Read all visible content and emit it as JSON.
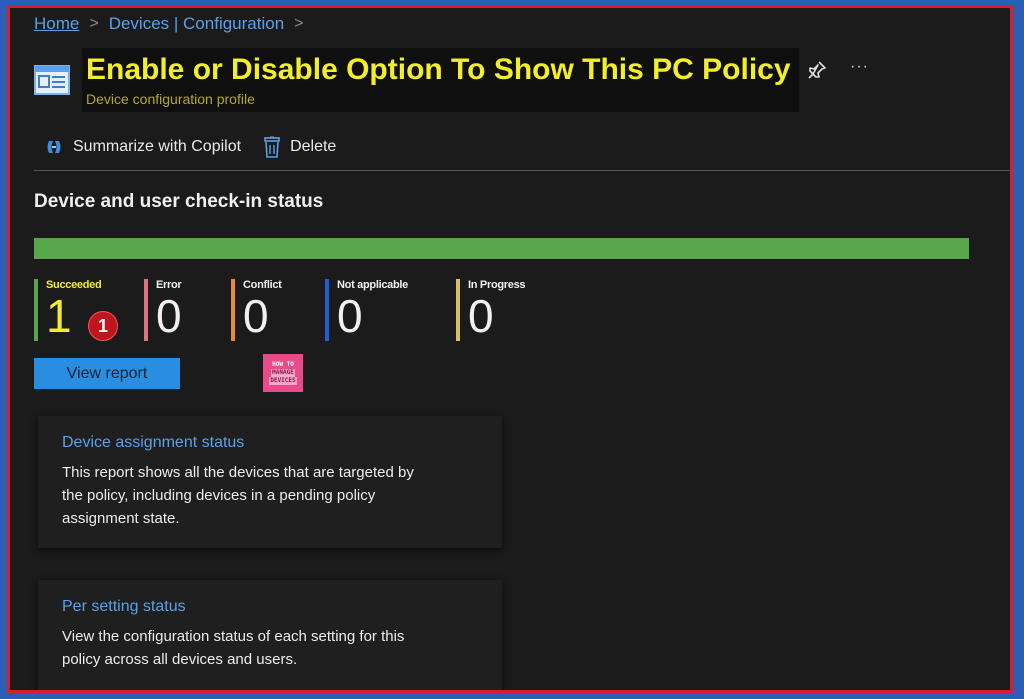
{
  "breadcrumb": {
    "home": "Home",
    "section": "Devices | Configuration",
    "separator": ">"
  },
  "header": {
    "title": "Enable or Disable Option To Show This PC Policy",
    "subtitle": "Device configuration profile",
    "more_label": "···"
  },
  "toolbar": {
    "copilot_label": "Summarize with Copilot",
    "delete_label": "Delete"
  },
  "checkin": {
    "title": "Device and user check-in status",
    "progress_succeeded_fraction": 1.0,
    "stats": [
      {
        "label": "Succeeded",
        "value": "1",
        "color": "#57a64a"
      },
      {
        "label": "Error",
        "value": "0",
        "color": "#e0737b"
      },
      {
        "label": "Conflict",
        "value": "0",
        "color": "#e9893a"
      },
      {
        "label": "Not applicable",
        "value": "0",
        "color": "#1f5fd6"
      },
      {
        "label": "In Progress",
        "value": "0",
        "color": "#d6c25a"
      }
    ],
    "annotation_badge": "1",
    "view_report_label": "View report"
  },
  "logo": {
    "line1": "HOW TO",
    "line2": "MANAGE",
    "line3": "DEVICES"
  },
  "cards": [
    {
      "title": "Device assignment status",
      "description": "This report shows all the devices that are targeted by the policy, including devices in a pending policy assignment state."
    },
    {
      "title": "Per setting status",
      "description": "View the configuration status of each setting for this policy across all devices and users."
    }
  ],
  "colors": {
    "accent": "#2a8ee0",
    "link": "#5aa0ea",
    "highlight": "#f2ee2a",
    "border": "#d81e2c"
  },
  "icons": [
    "profile-icon",
    "pin-icon",
    "more-icon",
    "copilot-icon",
    "trash-icon"
  ]
}
